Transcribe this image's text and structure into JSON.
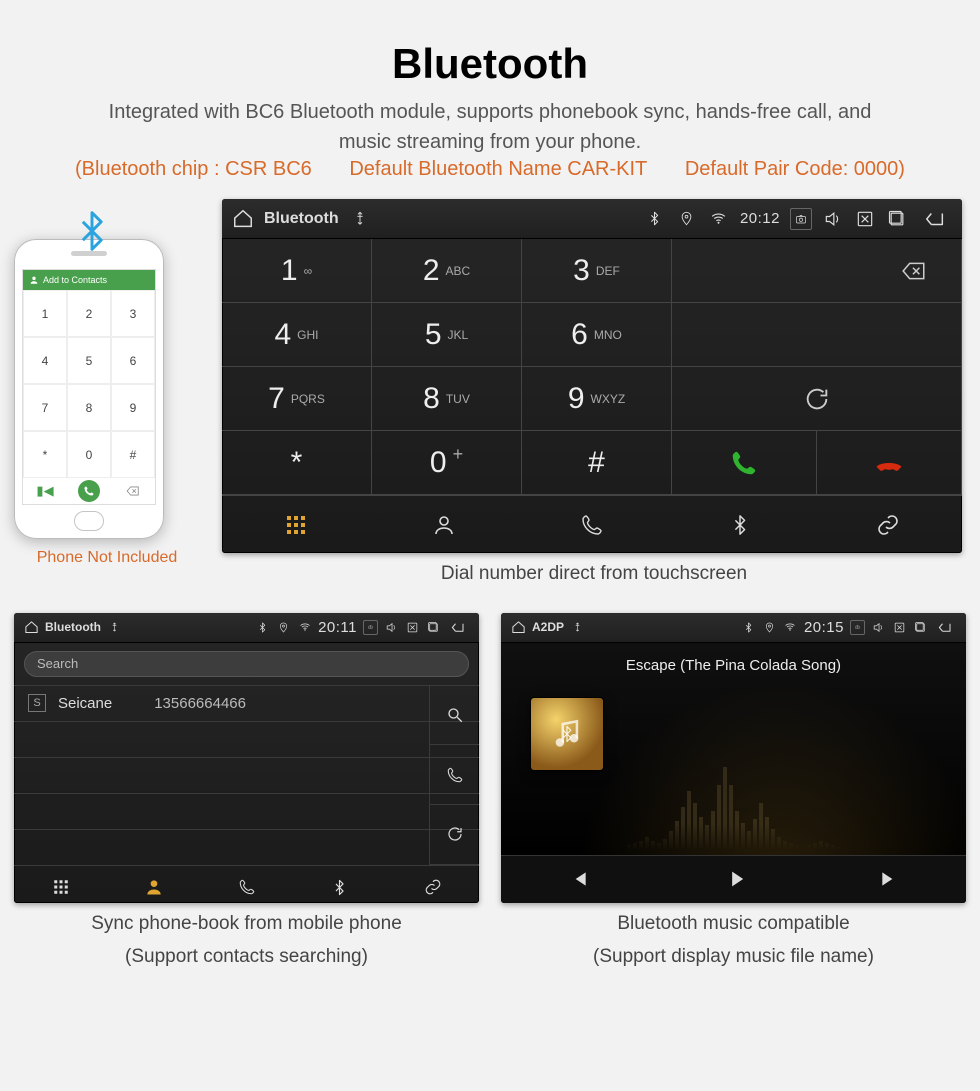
{
  "heading": "Bluetooth",
  "lead1": "Integrated with BC6 Bluetooth module, supports phonebook sync, hands-free call, and",
  "lead2": "music streaming from your phone.",
  "spec": {
    "chip": "(Bluetooth chip : CSR BC6",
    "name": "Default Bluetooth Name CAR-KIT",
    "pair": "Default Pair Code: 0000)"
  },
  "phone": {
    "addContacts": "Add to Contacts",
    "keys": [
      "1",
      "2",
      "3",
      "4",
      "5",
      "6",
      "7",
      "8",
      "9",
      "*",
      "0",
      "#"
    ],
    "caption": "Phone Not Included"
  },
  "dialer": {
    "title": "Bluetooth",
    "time": "20:12",
    "keys": [
      {
        "d": "1",
        "s": "∞"
      },
      {
        "d": "2",
        "s": "ABC"
      },
      {
        "d": "3",
        "s": "DEF"
      },
      {
        "d": "4",
        "s": "GHI"
      },
      {
        "d": "5",
        "s": "JKL"
      },
      {
        "d": "6",
        "s": "MNO"
      },
      {
        "d": "7",
        "s": "PQRS"
      },
      {
        "d": "8",
        "s": "TUV"
      },
      {
        "d": "9",
        "s": "WXYZ"
      },
      {
        "d": "*",
        "s": ""
      },
      {
        "d": "0",
        "s": "+"
      },
      {
        "d": "#",
        "s": ""
      }
    ],
    "caption": "Dial number direct from touchscreen"
  },
  "phonebook": {
    "title": "Bluetooth",
    "time": "20:11",
    "search": "Search",
    "contactTag": "S",
    "contactName": "Seicane",
    "contactNumber": "13566664466",
    "cap1": "Sync phone-book from mobile phone",
    "cap2": "(Support contacts searching)"
  },
  "player": {
    "title": "A2DP",
    "time": "20:15",
    "track": "Escape (The Pina Colada Song)",
    "cap1": "Bluetooth music compatible",
    "cap2": "(Support display music file name)"
  }
}
